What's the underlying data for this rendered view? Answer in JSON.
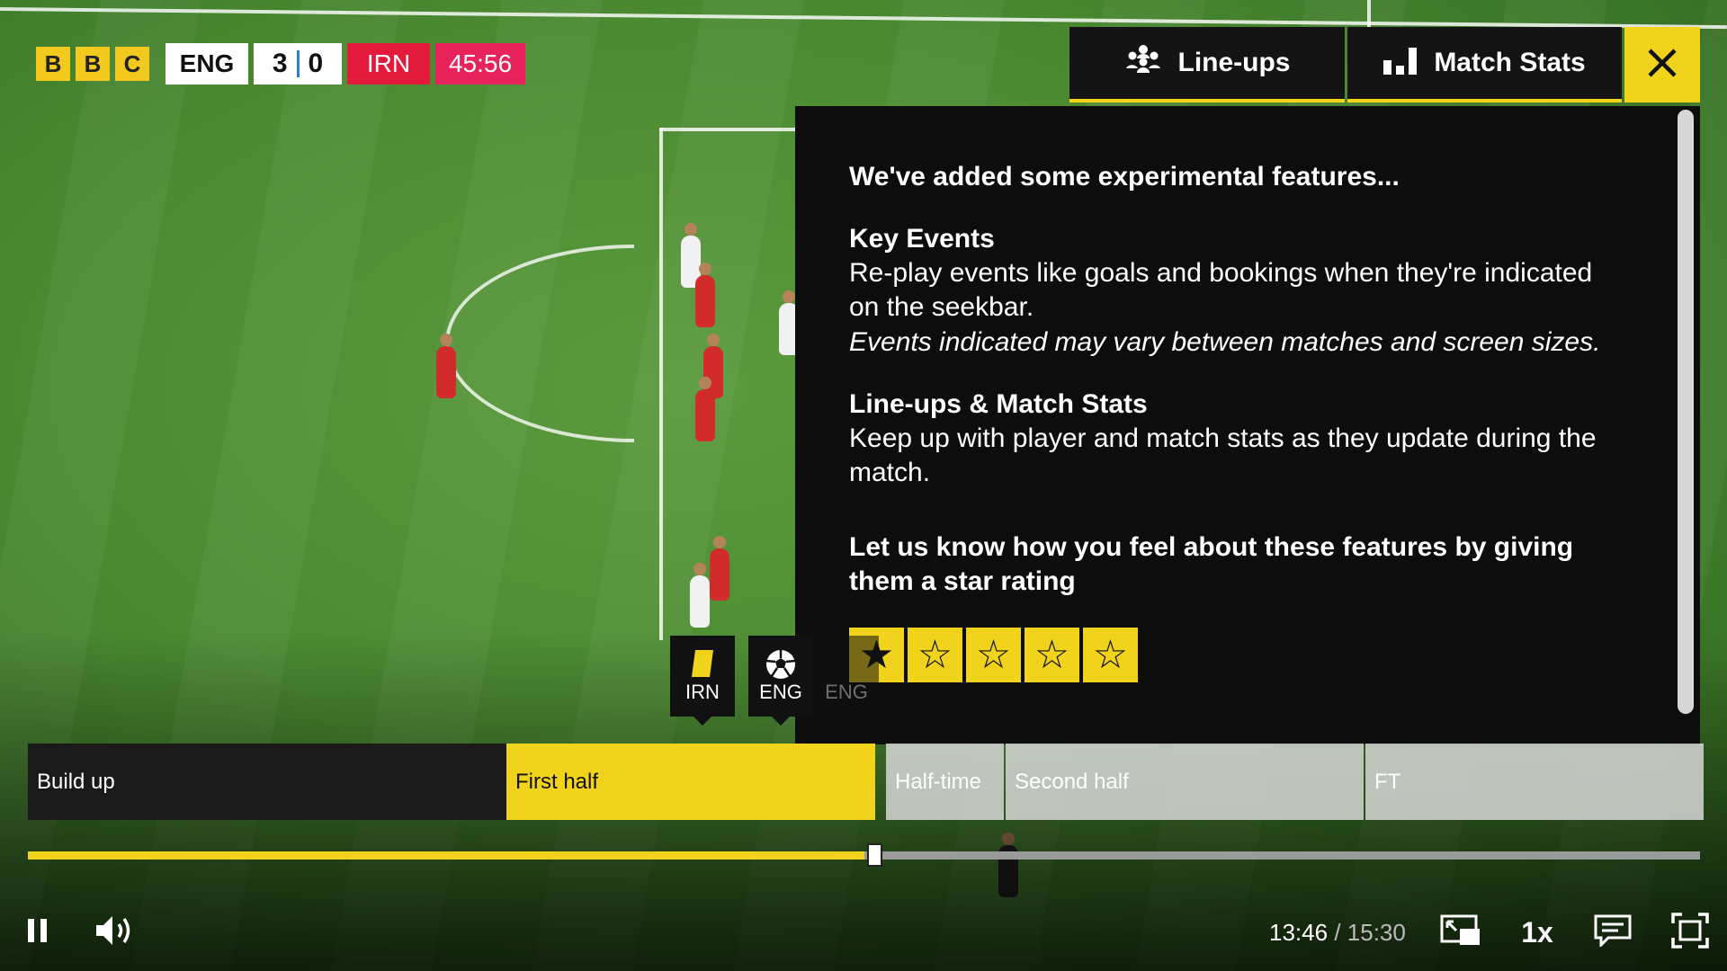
{
  "scoreboard": {
    "logo_letters": [
      "B",
      "B",
      "C"
    ],
    "home_team": "ENG",
    "home_score": "3",
    "away_score": "0",
    "away_team": "IRN",
    "match_clock": "45:56"
  },
  "tabs": {
    "lineups_label": "Line-ups",
    "stats_label": "Match Stats"
  },
  "panel": {
    "intro": "We've added some experimental features...",
    "key_events_heading": "Key Events",
    "key_events_body": "Re-play events like goals and bookings when they're indicated on the seekbar.",
    "key_events_note": "Events indicated may vary between matches and screen sizes.",
    "lineups_heading": "Line-ups & Match Stats",
    "lineups_body": "Keep up with player and match stats as they update during the match.",
    "cta": "Let us know how you feel about these features by giving them a star rating",
    "rating": {
      "selected": 1,
      "max": 5
    }
  },
  "markers": [
    {
      "team": "IRN",
      "icon": "yellow-card-icon"
    },
    {
      "team": "ENG",
      "icon": "football-icon"
    },
    {
      "team": "ENG",
      "icon": "football-icon"
    }
  ],
  "segments": {
    "build_up": "Build up",
    "first_half": "First half",
    "half_time": "Half-time",
    "second_half": "Second half",
    "ft": "FT"
  },
  "seek": {
    "progress_fraction": 0.5
  },
  "controls": {
    "current_time": "13:46",
    "separator": "/",
    "duration": "15:30",
    "speed": "1x"
  },
  "colors": {
    "accent_yellow": "#f2d31b",
    "irn_red": "#e21a3b",
    "clock_pink": "#e8225a",
    "panel_bg": "#0d0d0d"
  }
}
